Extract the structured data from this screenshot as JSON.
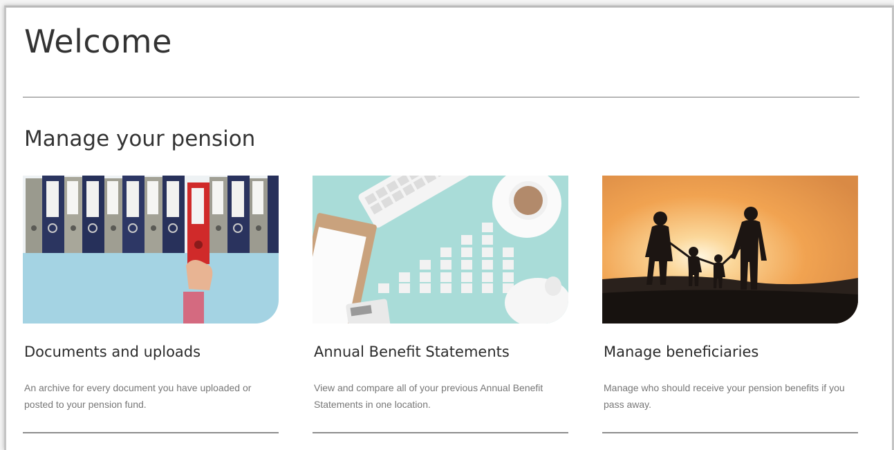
{
  "page": {
    "welcome": "Welcome",
    "section_title": "Manage your pension"
  },
  "cards": [
    {
      "title": "Documents and uploads",
      "description": "An archive for every document you have uploaded or posted to your pension fund.",
      "image": "binders-photo"
    },
    {
      "title": "Annual Benefit Statements",
      "description": "View and compare all of your previous Annual Benefit Statements in one location.",
      "image": "desk-chart-photo"
    },
    {
      "title": "Manage beneficiaries",
      "description": "Manage who should receive your pension benefits if you pass away.",
      "image": "family-sunset-photo"
    }
  ],
  "colors": {
    "teal_background": "#a9dcd8",
    "sky_blue": "#9ed1e0",
    "binder_red": "#d02a2a",
    "binder_navy": "#2b3560",
    "sunset_orange": "#f1a351"
  }
}
